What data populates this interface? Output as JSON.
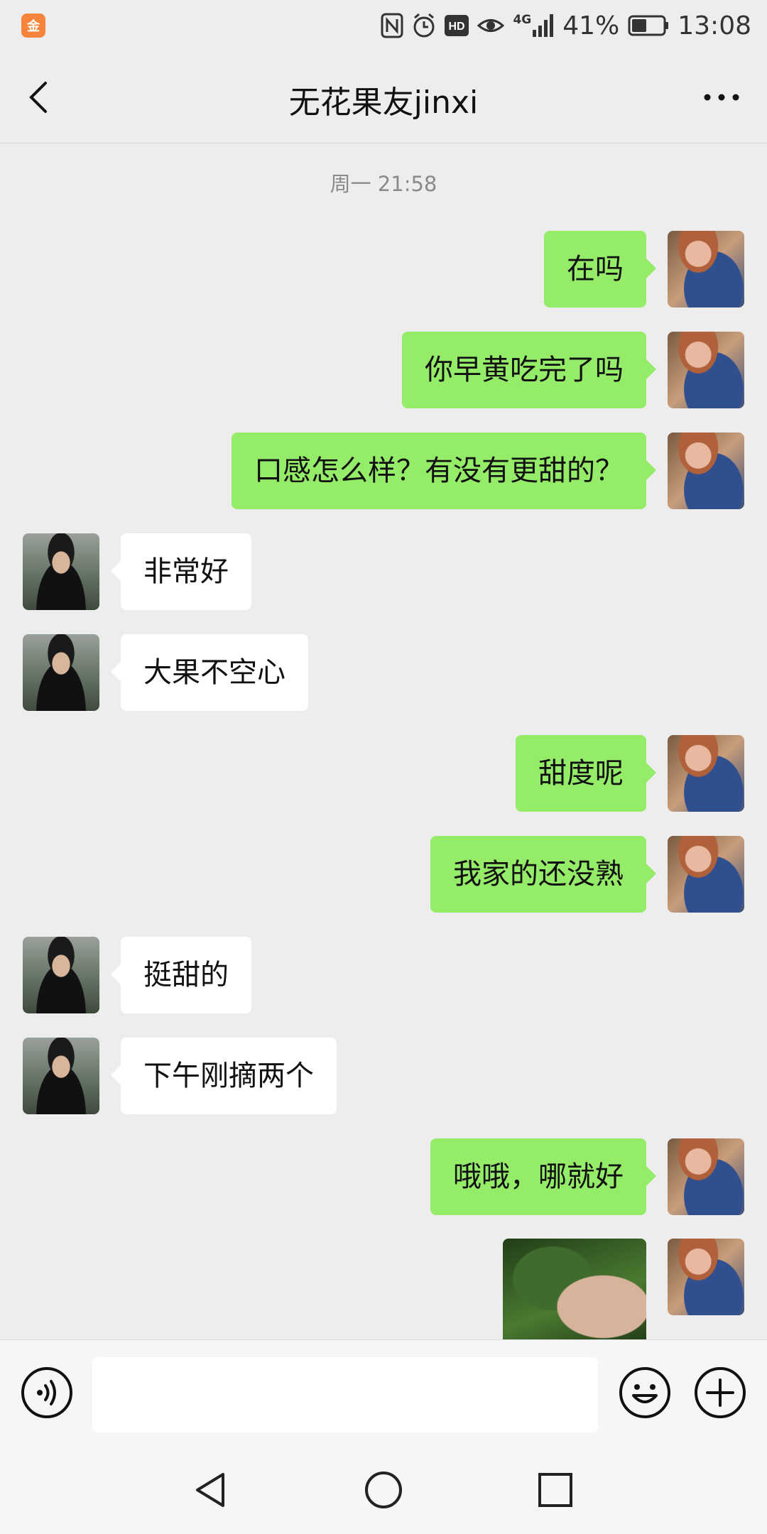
{
  "status_bar": {
    "app_icon_text": "金",
    "network": "4G",
    "battery_percent": "41%",
    "time": "13:08",
    "icons": [
      "nfc-icon",
      "alarm-icon",
      "hd-icon",
      "eye-icon",
      "signal-icon",
      "battery-icon"
    ]
  },
  "header": {
    "title": "无花果友jinxi",
    "back_icon": "chevron-left-icon",
    "more_icon": "more-dots-icon"
  },
  "chat": {
    "timestamp": "周一 21:58",
    "messages": [
      {
        "side": "sent",
        "text": "在吗"
      },
      {
        "side": "sent",
        "text": "你早黄吃完了吗"
      },
      {
        "side": "sent",
        "text": "口感怎么样？有没有更甜的？"
      },
      {
        "side": "received",
        "text": "非常好"
      },
      {
        "side": "received",
        "text": "大果不空心"
      },
      {
        "side": "sent",
        "text": "甜度呢"
      },
      {
        "side": "sent",
        "text": "我家的还没熟"
      },
      {
        "side": "received",
        "text": "挺甜的"
      },
      {
        "side": "received",
        "text": "下午刚摘两个"
      },
      {
        "side": "sent",
        "text": "哦哦，哪就好"
      },
      {
        "side": "sent",
        "type": "image"
      }
    ]
  },
  "input_bar": {
    "value": "",
    "icons": [
      "voice-icon",
      "emoji-icon",
      "plus-icon"
    ]
  },
  "nav_bar": {
    "icons": [
      "nav-back-icon",
      "nav-home-icon",
      "nav-recent-icon"
    ]
  },
  "colors": {
    "background": "#ededed",
    "sent_bubble": "#95ec69",
    "received_bubble": "#ffffff",
    "timestamp": "#8a8a8a"
  }
}
